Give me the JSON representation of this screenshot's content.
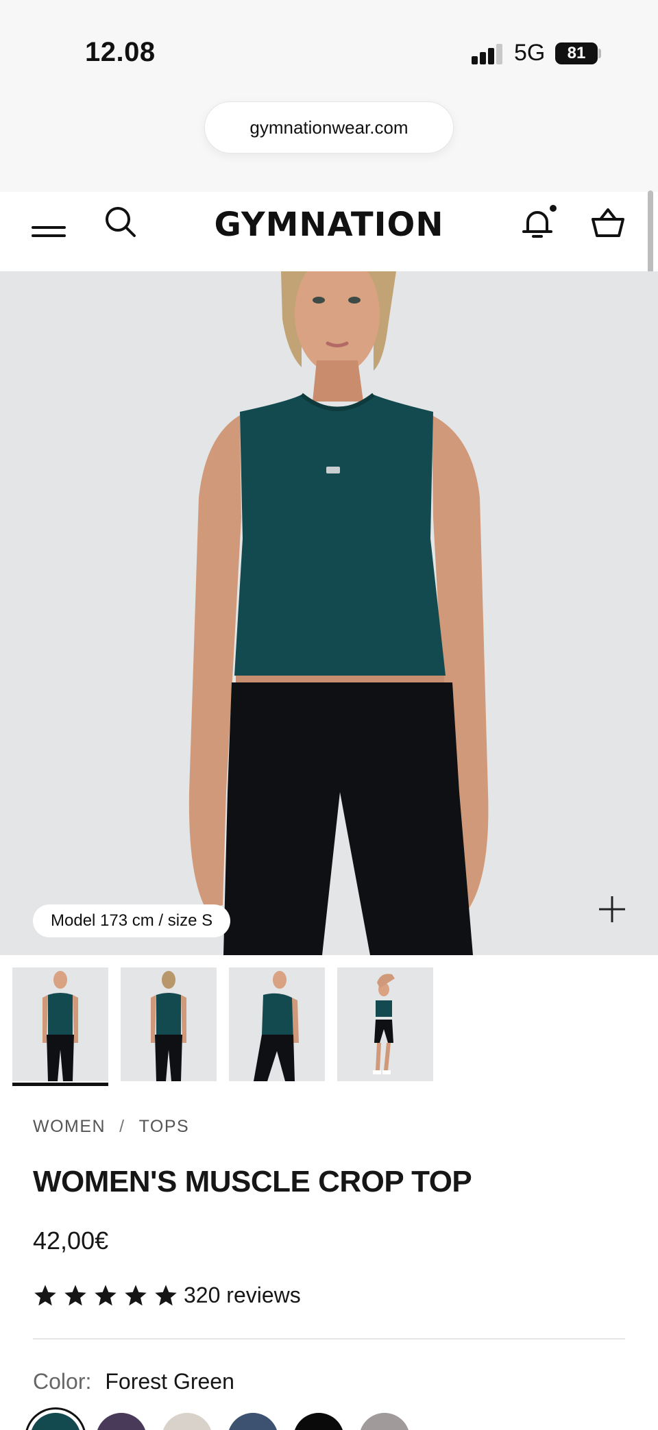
{
  "status_bar": {
    "time": "12.08",
    "network": "5G",
    "battery": "81"
  },
  "browser": {
    "url": "gymnationwear.com"
  },
  "header": {
    "logo": "GYMNATION"
  },
  "gallery": {
    "model_info": "Model 173 cm / size S",
    "thumbnails": 4,
    "active_thumbnail": 1
  },
  "product": {
    "breadcrumb": [
      "WOMEN",
      "TOPS"
    ],
    "breadcrumb_separator": "/",
    "title": "WOMEN'S MUSCLE CROP TOP",
    "price": "42,00€",
    "rating_stars": 5,
    "reviews": "320 reviews",
    "color_label": "Color:",
    "color_value": "Forest Green",
    "swatches": [
      {
        "name": "Forest Green",
        "hex": "#134a4f",
        "selected": true
      },
      {
        "name": "Purple",
        "hex": "#4a3a5a",
        "selected": false
      },
      {
        "name": "Beige",
        "hex": "#d8d2ca",
        "selected": false
      },
      {
        "name": "Navy Blue",
        "hex": "#3c5270",
        "selected": false
      },
      {
        "name": "Black",
        "hex": "#0a0a0a",
        "selected": false
      },
      {
        "name": "Taupe",
        "hex": "#a09a9a",
        "selected": false
      }
    ]
  },
  "colors": {
    "accent": "#111111",
    "hero_bg": "#e4e5e7",
    "tank_top": "#134a4f"
  }
}
